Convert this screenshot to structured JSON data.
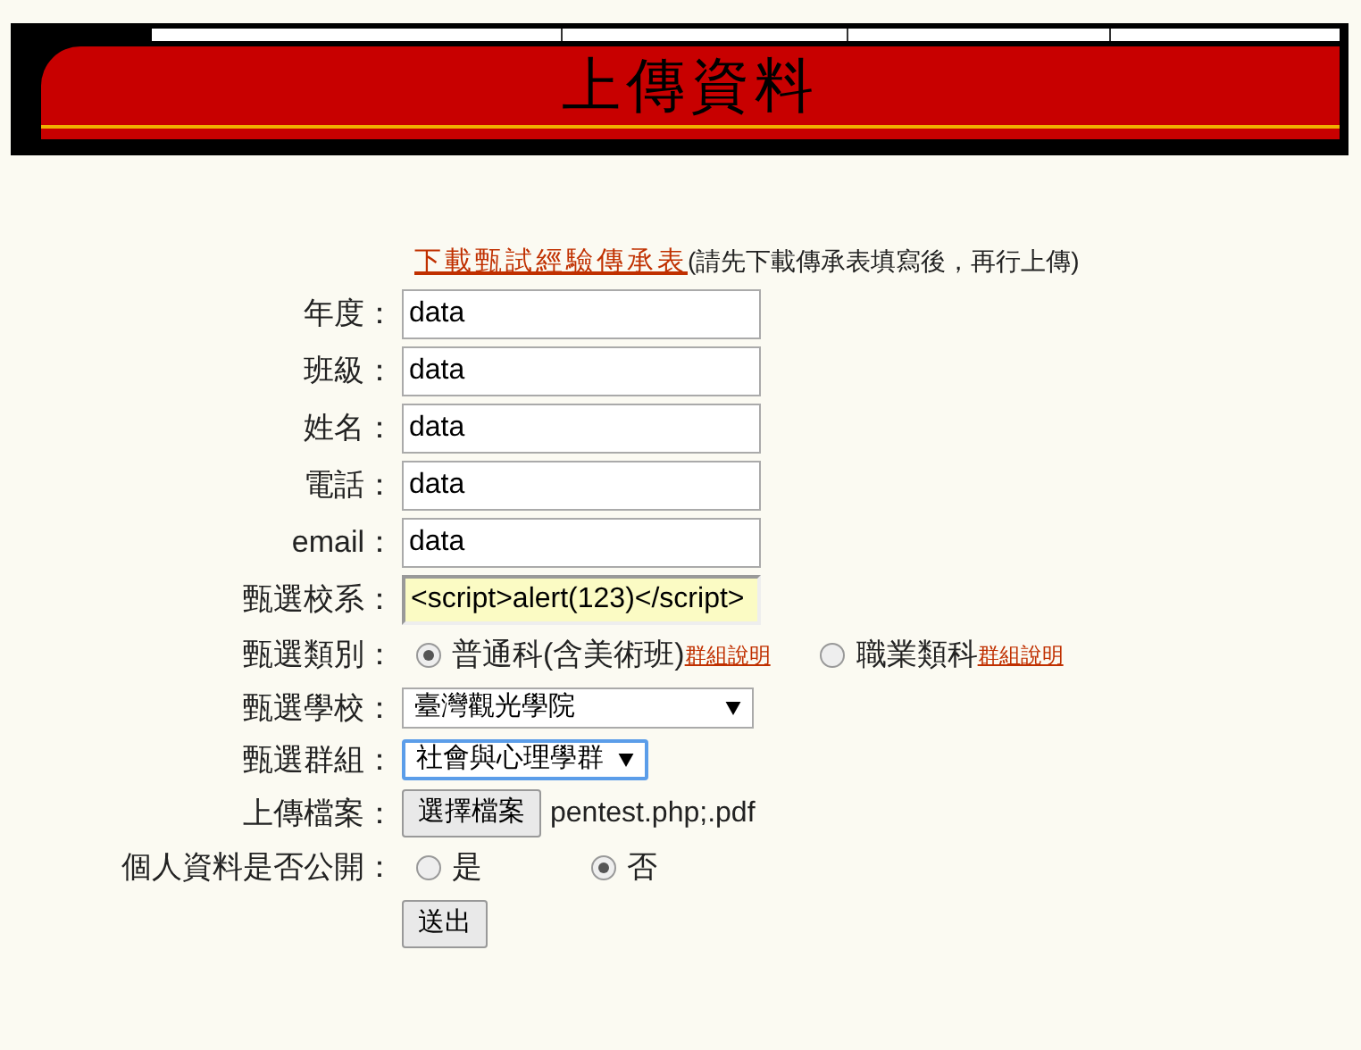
{
  "header": {
    "title": "上傳資料"
  },
  "download": {
    "link": "下載甄試經驗傳承表",
    "note": "(請先下載傳承表填寫後，再行上傳)"
  },
  "fields": [
    {
      "kind": "text",
      "label": "年度：",
      "value": "data",
      "autofilled": false
    },
    {
      "kind": "text",
      "label": "班級：",
      "value": "data",
      "autofilled": false
    },
    {
      "kind": "text",
      "label": "姓名：",
      "value": "data",
      "autofilled": false
    },
    {
      "kind": "text",
      "label": "電話：",
      "value": "data",
      "autofilled": false
    },
    {
      "kind": "text",
      "label": "email：",
      "value": "data",
      "autofilled": false
    },
    {
      "kind": "text",
      "label": "甄選校系：",
      "value": "<script>alert(123)</script>",
      "autofilled": true
    },
    {
      "kind": "radio",
      "label": "甄選類別：",
      "options": [
        {
          "label": "普通科(含美術班)",
          "link": "群組說明",
          "selected": true
        },
        {
          "label": "職業類科",
          "link": "群組說明",
          "selected": false
        }
      ]
    },
    {
      "kind": "select",
      "label": "甄選學校：",
      "value": "臺灣觀光學院",
      "focused": false
    },
    {
      "kind": "select",
      "label": "甄選群組：",
      "value": "社會與心理學群",
      "focused": true
    },
    {
      "kind": "file",
      "label": "上傳檔案：",
      "button": "選擇檔案",
      "filename": "pentest.php;.pdf"
    },
    {
      "kind": "radio",
      "label": "個人資料是否公開：",
      "options": [
        {
          "label": "是",
          "selected": false
        },
        {
          "label": "否",
          "selected": true
        }
      ]
    },
    {
      "kind": "submit",
      "button": "送出"
    }
  ]
}
